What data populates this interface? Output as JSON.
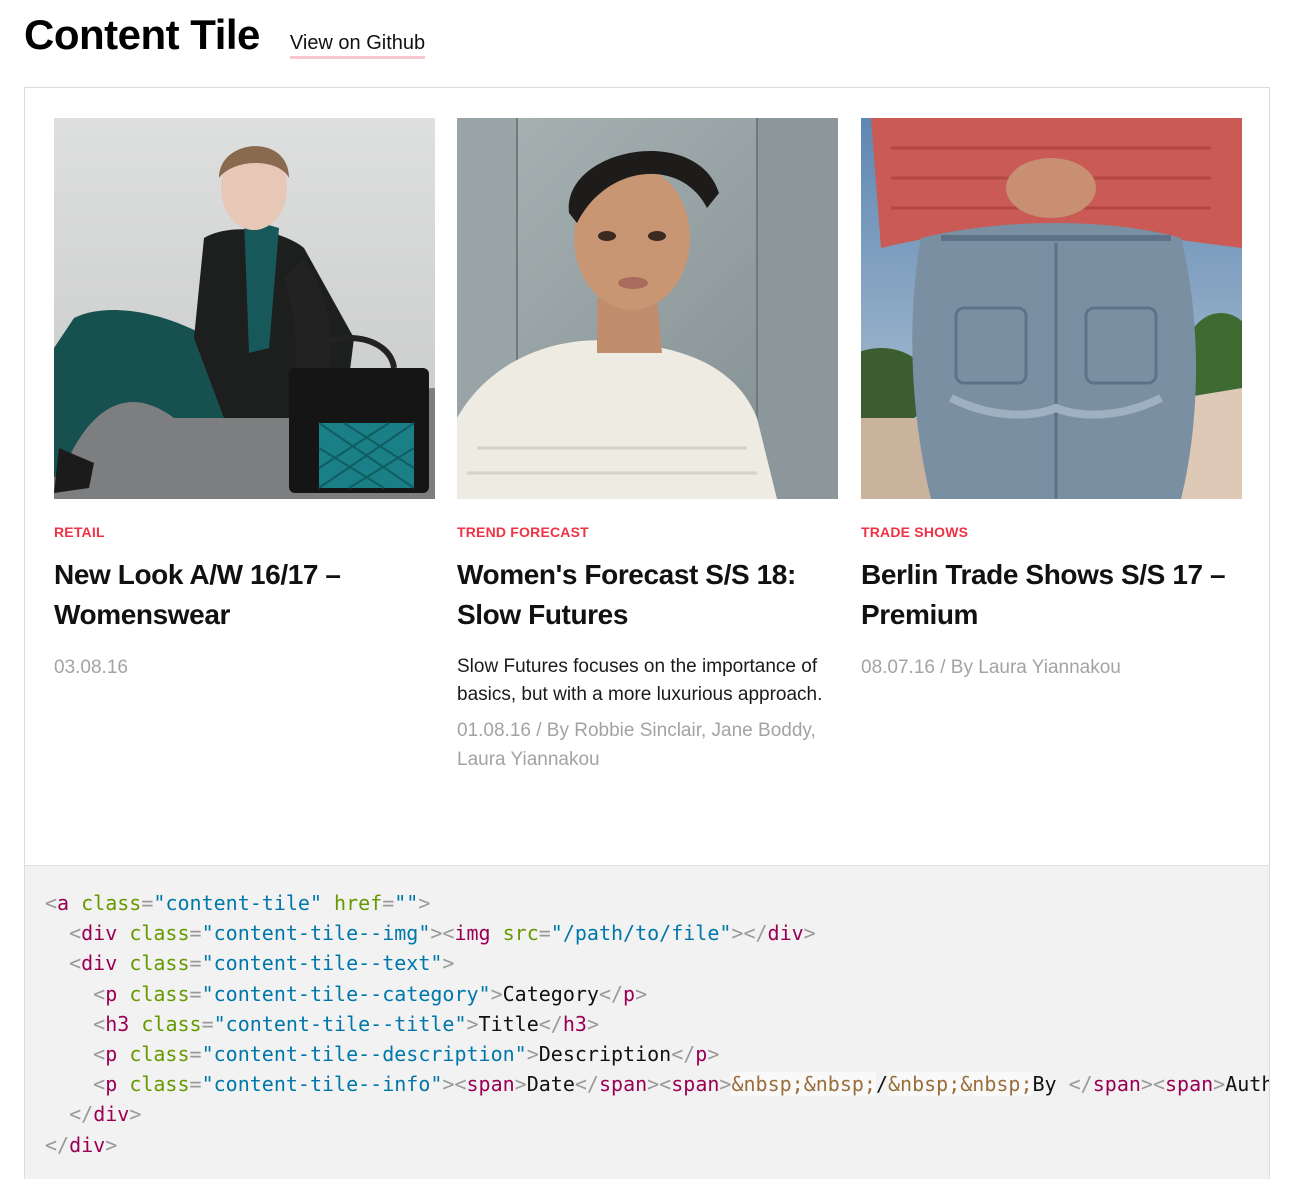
{
  "header": {
    "title": "Content Tile",
    "github_link": "View on Github"
  },
  "tiles": [
    {
      "image_desc": "woman-teal-outfit-handbag",
      "category": "RETAIL",
      "title": "New Look A/W 16/17 – Womenswear",
      "description": "",
      "info": "03.08.16"
    },
    {
      "image_desc": "woman-portrait-black-cap",
      "category": "TREND FORECAST",
      "title": "Women's Forecast S/S 18: Slow Futures",
      "description": "Slow Futures focuses on the importance of basics, but with a more luxurious approach.",
      "info": "01.08.16  /  By Robbie Sinclair, Jane Boddy, Laura Yiannakou"
    },
    {
      "image_desc": "person-red-sweater-jeans",
      "category": "TRADE SHOWS",
      "title": "Berlin Trade Shows S/S 17 – Premium",
      "description": "",
      "info": "08.07.16  /  By Laura Yiannakou"
    }
  ],
  "code": {
    "line1": [
      "<",
      "a",
      " ",
      "class",
      "=",
      "\"content-tile\"",
      " ",
      "href",
      "=",
      "\"\"",
      ">"
    ],
    "tokens": {
      "cls_tile": "\"content-tile\"",
      "cls_img": "\"content-tile--img\"",
      "img_src": "\"/path/to/file\"",
      "cls_text": "\"content-tile--text\"",
      "cls_category": "\"content-tile--category\"",
      "cls_title": "\"content-tile--title\"",
      "cls_description": "\"content-tile--description\"",
      "cls_info": "\"content-tile--info\"",
      "text_category": "Category",
      "text_title": "Title",
      "text_description": "Description",
      "text_date": "Date",
      "entity": "&nbsp;&nbsp;",
      "slash": "/",
      "text_by": "By ",
      "text_auth": "Auth"
    }
  },
  "colors": {
    "category": "#ee3344",
    "link_underline": "#f8c6cf",
    "meta": "#a3a3a3",
    "code_bg": "#f2f2f2",
    "code_tag": "#990055",
    "code_attr": "#669900",
    "code_value": "#0077aa"
  }
}
